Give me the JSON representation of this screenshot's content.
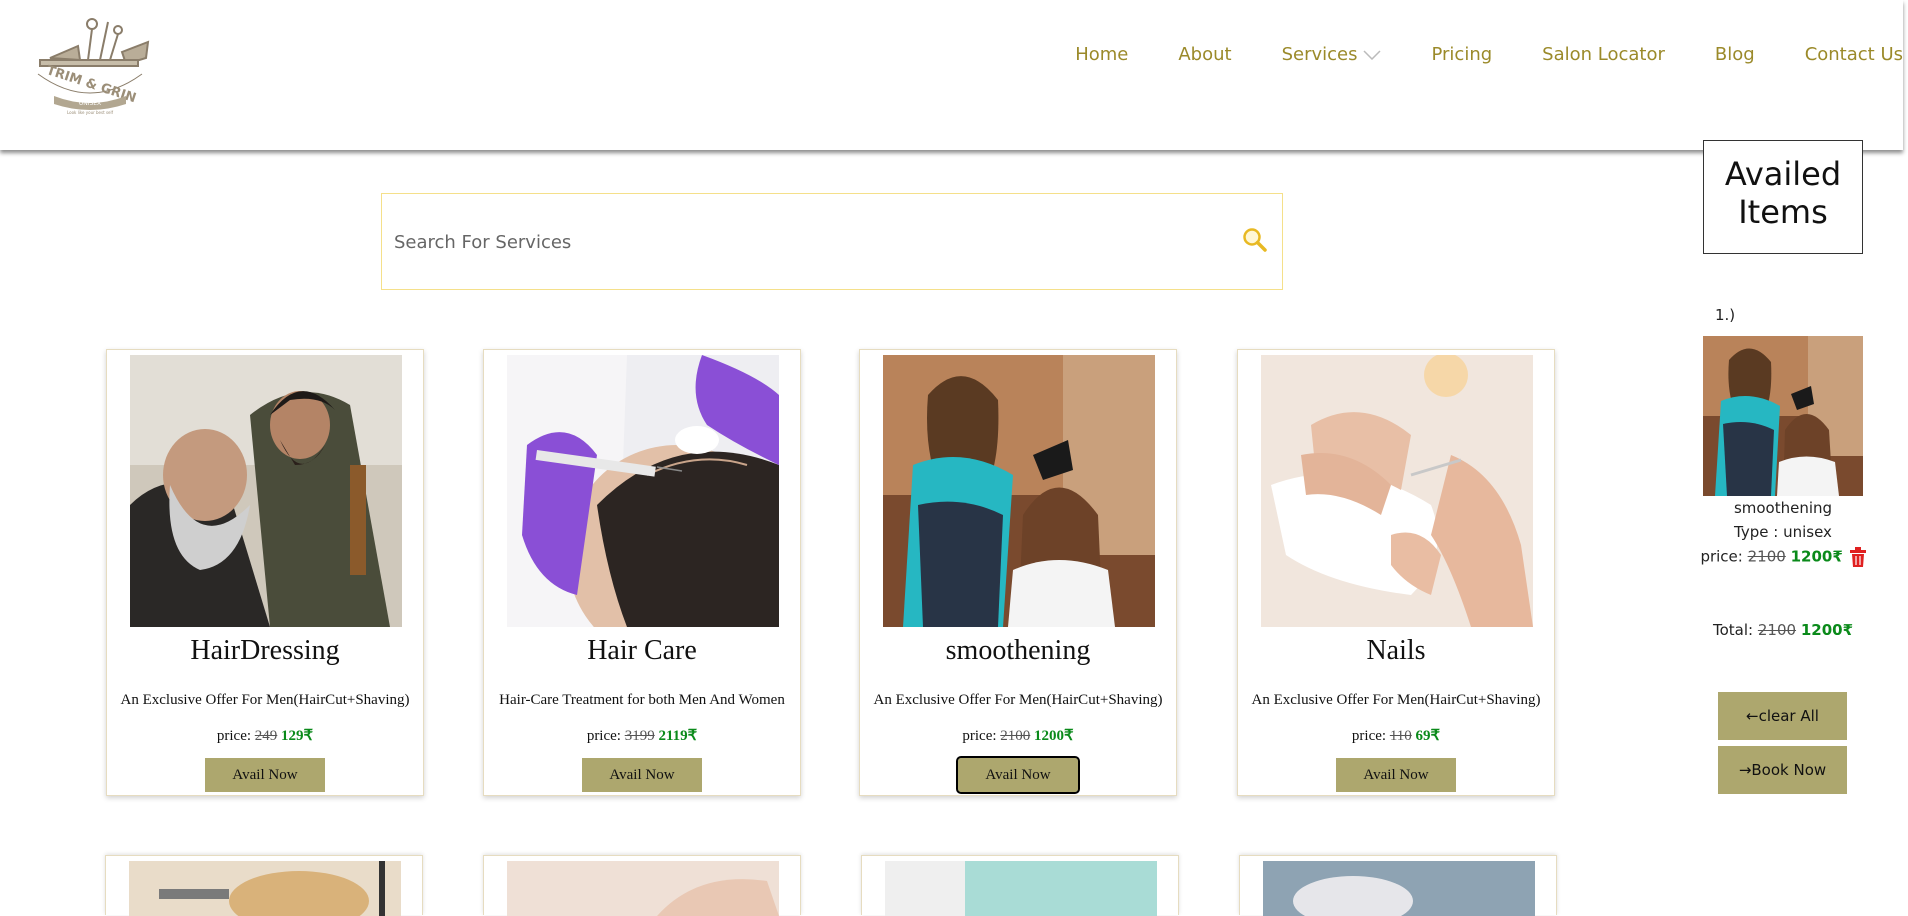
{
  "header": {
    "logo": {
      "text": "TRIM & GRIN",
      "sub": "UNISEX",
      "tagline": "Look like your best self"
    },
    "nav": [
      {
        "label": "Home"
      },
      {
        "label": "About"
      },
      {
        "label": "Services",
        "has_dropdown": true
      },
      {
        "label": "Pricing"
      },
      {
        "label": "Salon Locator"
      },
      {
        "label": "Blog"
      },
      {
        "label": "Contact Us"
      }
    ]
  },
  "search": {
    "placeholder": "Search For Services",
    "value": ""
  },
  "services": [
    {
      "title": "HairDressing",
      "desc": "An Exclusive Offer For Men(HairCut+Shaving)",
      "price_label": "price:",
      "old_price": "249",
      "new_price": "129₹",
      "button": "Avail Now"
    },
    {
      "title": "Hair Care",
      "desc": "Hair-Care Treatment for both Men And Women",
      "price_label": "price:",
      "old_price": "3199",
      "new_price": "2119₹",
      "button": "Avail Now"
    },
    {
      "title": "smoothening",
      "desc": "An Exclusive Offer For Men(HairCut+Shaving)",
      "price_label": "price:",
      "old_price": "2100",
      "new_price": "1200₹",
      "button": "Avail Now"
    },
    {
      "title": "Nails",
      "desc": "An Exclusive Offer For Men(HairCut+Shaving)",
      "price_label": "price:",
      "old_price": "110",
      "new_price": "69₹",
      "button": "Avail Now"
    }
  ],
  "availed": {
    "title": "Availed Items",
    "items": [
      {
        "index": "1.)",
        "name": "smoothening",
        "type": "Type : unisex",
        "price_label": "price:",
        "old_price": "2100",
        "new_price": "1200₹"
      }
    ],
    "total_label": "Total:",
    "total_old": "2100",
    "total_new": "1200₹",
    "clear_label": "←clear All",
    "book_label": "→Book Now"
  },
  "colors": {
    "accent": "#9b8a2a",
    "button": "#ada76e",
    "price_green": "#0a8a1a",
    "search_border": "#f5e08a"
  }
}
